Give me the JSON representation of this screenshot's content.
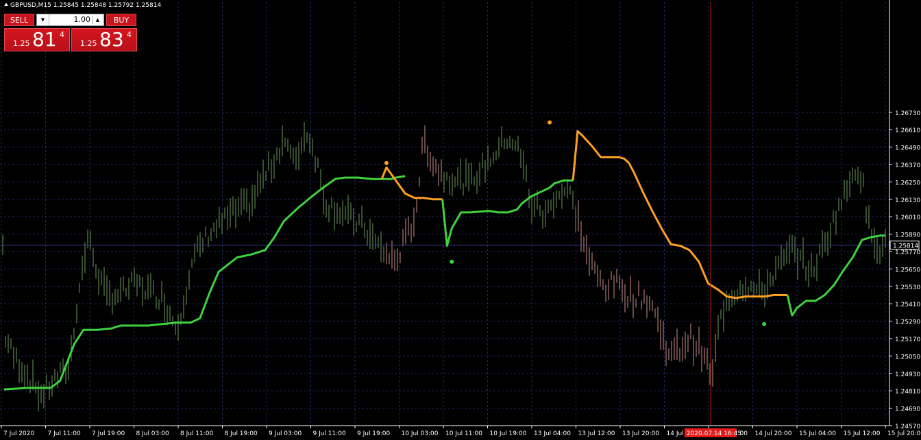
{
  "header": {
    "symbol_line": "GBPUSD,M15  1.25845 1.25848 1.25792 1.25814"
  },
  "trade_panel": {
    "sell_label": "SELL",
    "buy_label": "BUY",
    "lot_value": "1.00",
    "sell_price_prefix": "1.25",
    "sell_price_big": "81",
    "sell_price_sup": "4",
    "buy_price_prefix": "1.25",
    "buy_price_big": "83",
    "buy_price_sup": "4"
  },
  "colors": {
    "background": "#000000",
    "grid": "#1c2a5c",
    "axis_text": "#ffffff",
    "bull_bar": "#6b9b5a",
    "bear_bar": "#d0908a",
    "green_line": "#3fd33f",
    "orange_line": "#ffa020",
    "vline": "#a02010",
    "price_line": "#3a3a90",
    "time_highlight": "#e21b1b"
  },
  "chart_data": {
    "type": "line",
    "symbol": "GBPUSD",
    "timeframe": "M15",
    "ohlc_current": {
      "open": 1.25845,
      "high": 1.25848,
      "low": 1.25792,
      "close": 1.25814
    },
    "current_price_label": "1.25814",
    "y_ticks": [
      "1.26730",
      "1.26610",
      "1.26490",
      "1.26370",
      "1.26250",
      "1.26130",
      "1.26010",
      "1.25890",
      "1.25770",
      "1.25650",
      "1.25530",
      "1.25410",
      "1.25290",
      "1.25170",
      "1.25050",
      "1.24930",
      "1.24810",
      "1.24690",
      "1.24570"
    ],
    "ylim": [
      1.2457,
      1.2749
    ],
    "x_ticks": [
      "7 Jul 2020",
      "7 Jul 11:00",
      "7 Jul 19:00",
      "8 Jul 03:00",
      "8 Jul 11:00",
      "8 Jul 19:00",
      "9 Jul 03:00",
      "9 Jul 11:00",
      "9 Jul 19:00",
      "10 Jul 03:00",
      "10 Jul 11:00",
      "10 Jul 19:00",
      "13 Jul 04:00",
      "13 Jul 12:00",
      "13 Jul 20:00",
      "14 Jul 04:00",
      "14 Jul 12:00",
      "14 Jul 20:00",
      "15 Jul 04:00",
      "15 Jul 12:00",
      "15 Jul 20:00"
    ],
    "crosshair_time_label": "2020.07.14 16:45",
    "price_anchors": [
      [
        0,
        1.252
      ],
      [
        2,
        1.2505
      ],
      [
        5,
        1.2492
      ],
      [
        8,
        1.2478
      ],
      [
        11,
        1.2489
      ],
      [
        14,
        1.2498
      ],
      [
        16,
        1.255
      ],
      [
        18,
        1.2587
      ],
      [
        20,
        1.2563
      ],
      [
        22,
        1.2546
      ],
      [
        25,
        1.2548
      ],
      [
        28,
        1.2555
      ],
      [
        31,
        1.255
      ],
      [
        34,
        1.2545
      ],
      [
        37,
        1.2525
      ],
      [
        39,
        1.255
      ],
      [
        41,
        1.2575
      ],
      [
        44,
        1.259
      ],
      [
        47,
        1.2598
      ],
      [
        50,
        1.2605
      ],
      [
        53,
        1.261
      ],
      [
        55,
        1.2625
      ],
      [
        58,
        1.264
      ],
      [
        60,
        1.2656
      ],
      [
        62,
        1.2638
      ],
      [
        65,
        1.266
      ],
      [
        67,
        1.264
      ],
      [
        69,
        1.261
      ],
      [
        72,
        1.2605
      ],
      [
        74,
        1.26
      ],
      [
        77,
        1.2595
      ],
      [
        79,
        1.2585
      ],
      [
        82,
        1.2575
      ],
      [
        84,
        1.257
      ],
      [
        86,
        1.2585
      ],
      [
        88,
        1.26
      ],
      [
        89,
        1.2625
      ],
      [
        90,
        1.2655
      ],
      [
        92,
        1.2638
      ],
      [
        94,
        1.263
      ],
      [
        96,
        1.2628
      ],
      [
        98,
        1.2626
      ],
      [
        100,
        1.2625
      ],
      [
        102,
        1.2632
      ],
      [
        104,
        1.264
      ],
      [
        106,
        1.2648
      ],
      [
        108,
        1.2656
      ],
      [
        110,
        1.265
      ],
      [
        112,
        1.2628
      ],
      [
        113,
        1.2608
      ],
      [
        114,
        1.261
      ],
      [
        116,
        1.26
      ],
      [
        118,
        1.2615
      ],
      [
        120,
        1.2618
      ],
      [
        121,
        1.262
      ],
      [
        123,
        1.26
      ],
      [
        125,
        1.2575
      ],
      [
        127,
        1.256
      ],
      [
        129,
        1.2553
      ],
      [
        131,
        1.2556
      ],
      [
        133,
        1.255
      ],
      [
        135,
        1.2545
      ],
      [
        137,
        1.2546
      ],
      [
        139,
        1.254
      ],
      [
        141,
        1.252
      ],
      [
        143,
        1.2505
      ],
      [
        145,
        1.251
      ],
      [
        147,
        1.2518
      ],
      [
        149,
        1.251
      ],
      [
        151,
        1.2498
      ],
      [
        152,
        1.249
      ],
      [
        153,
        1.2522
      ],
      [
        155,
        1.2545
      ],
      [
        157,
        1.255
      ],
      [
        159,
        1.2555
      ],
      [
        161,
        1.255
      ],
      [
        163,
        1.255
      ],
      [
        165,
        1.2562
      ],
      [
        167,
        1.257
      ],
      [
        169,
        1.2578
      ],
      [
        171,
        1.2572
      ],
      [
        173,
        1.2562
      ],
      [
        175,
        1.2575
      ],
      [
        177,
        1.259
      ],
      [
        179,
        1.2608
      ],
      [
        181,
        1.262
      ],
      [
        182,
        1.2635
      ],
      [
        184,
        1.263
      ],
      [
        185,
        1.26
      ],
      [
        187,
        1.2585
      ],
      [
        188,
        1.2578
      ],
      [
        189,
        1.2581
      ]
    ],
    "series": [
      {
        "color": "#3fd33f",
        "values": [
          [
            0,
            1.2482
          ],
          [
            5,
            1.2483
          ],
          [
            8,
            1.2483
          ],
          [
            10,
            1.2483
          ],
          [
            12,
            1.2488
          ],
          [
            15,
            1.2513
          ],
          [
            17,
            1.2523
          ],
          [
            20,
            1.2523
          ],
          [
            23,
            1.2524
          ],
          [
            25,
            1.2526
          ],
          [
            28,
            1.2526
          ],
          [
            31,
            1.2526
          ],
          [
            34,
            1.2527
          ],
          [
            37,
            1.2528
          ],
          [
            40,
            1.2528
          ],
          [
            42,
            1.2531
          ],
          [
            44,
            1.2548
          ],
          [
            46,
            1.2563
          ],
          [
            48,
            1.2568
          ],
          [
            50,
            1.2573
          ],
          [
            53,
            1.2575
          ],
          [
            56,
            1.2578
          ],
          [
            58,
            1.2587
          ],
          [
            60,
            1.2598
          ],
          [
            63,
            1.2607
          ],
          [
            66,
            1.2615
          ],
          [
            68,
            1.262
          ],
          [
            71,
            1.2627
          ],
          [
            73,
            1.2628
          ],
          [
            76,
            1.2628
          ],
          [
            79,
            1.2627
          ],
          [
            81,
            1.2627
          ],
          [
            83,
            1.2627
          ],
          [
            84,
            1.2628
          ],
          [
            86,
            1.2629
          ]
        ]
      },
      {
        "color": "#ffa020",
        "values": [
          [
            81,
            1.2627
          ],
          [
            82,
            1.2635
          ],
          [
            84,
            1.2626
          ],
          [
            86,
            1.2617
          ],
          [
            88,
            1.2614
          ],
          [
            90,
            1.2614
          ],
          [
            92,
            1.2613
          ],
          [
            94,
            1.2613
          ]
        ]
      },
      {
        "color": "#3fd33f",
        "values": [
          [
            94,
            1.2613
          ],
          [
            95,
            1.2581
          ],
          [
            96,
            1.2593
          ],
          [
            98,
            1.2604
          ],
          [
            100,
            1.2604
          ],
          [
            104,
            1.2605
          ],
          [
            106,
            1.2604
          ],
          [
            108,
            1.2604
          ],
          [
            110,
            1.2606
          ],
          [
            111,
            1.261
          ],
          [
            113,
            1.2615
          ],
          [
            115,
            1.2618
          ],
          [
            117,
            1.2621
          ],
          [
            118,
            1.2624
          ],
          [
            120,
            1.2626
          ],
          [
            122,
            1.2626
          ]
        ]
      },
      {
        "color": "#ffa020",
        "values": [
          [
            122,
            1.2626
          ],
          [
            123,
            1.266
          ],
          [
            124,
            1.2657
          ],
          [
            126,
            1.265
          ],
          [
            128,
            1.2642
          ],
          [
            130,
            1.2642
          ],
          [
            132,
            1.2642
          ],
          [
            133,
            1.2641
          ],
          [
            134,
            1.2638
          ],
          [
            135,
            1.2632
          ],
          [
            137,
            1.2618
          ],
          [
            139,
            1.2605
          ],
          [
            141,
            1.2593
          ],
          [
            143,
            1.2582
          ],
          [
            145,
            1.2581
          ],
          [
            147,
            1.2578
          ],
          [
            149,
            1.257
          ],
          [
            151,
            1.2555
          ],
          [
            153,
            1.2551
          ],
          [
            155,
            1.2546
          ],
          [
            157,
            1.2545
          ],
          [
            159,
            1.2546
          ],
          [
            161,
            1.2546
          ],
          [
            163,
            1.2546
          ],
          [
            165,
            1.2547
          ],
          [
            167,
            1.2547
          ],
          [
            168,
            1.2547
          ]
        ]
      },
      {
        "color": "#3fd33f",
        "values": [
          [
            168,
            1.2547
          ],
          [
            169,
            1.2533
          ],
          [
            170,
            1.2538
          ],
          [
            172,
            1.2543
          ],
          [
            174,
            1.2543
          ],
          [
            176,
            1.2547
          ],
          [
            178,
            1.2554
          ],
          [
            180,
            1.2564
          ],
          [
            182,
            1.2573
          ],
          [
            184,
            1.2585
          ],
          [
            186,
            1.2587
          ],
          [
            188,
            1.2588
          ],
          [
            189,
            1.2588
          ]
        ]
      }
    ],
    "markers": [
      {
        "x": 82,
        "y": 1.2638,
        "color": "#ffa020"
      },
      {
        "x": 96,
        "y": 1.257,
        "color": "#3fd33f"
      },
      {
        "x": 117,
        "y": 1.2666,
        "color": "#ffa020"
      },
      {
        "x": 163,
        "y": 1.2527,
        "color": "#3fd33f"
      }
    ],
    "bear_ranges": [
      [
        82,
        94
      ],
      [
        123,
        153
      ]
    ],
    "crosshair_x": 151.5,
    "x_range": [
      0,
      189
    ]
  }
}
